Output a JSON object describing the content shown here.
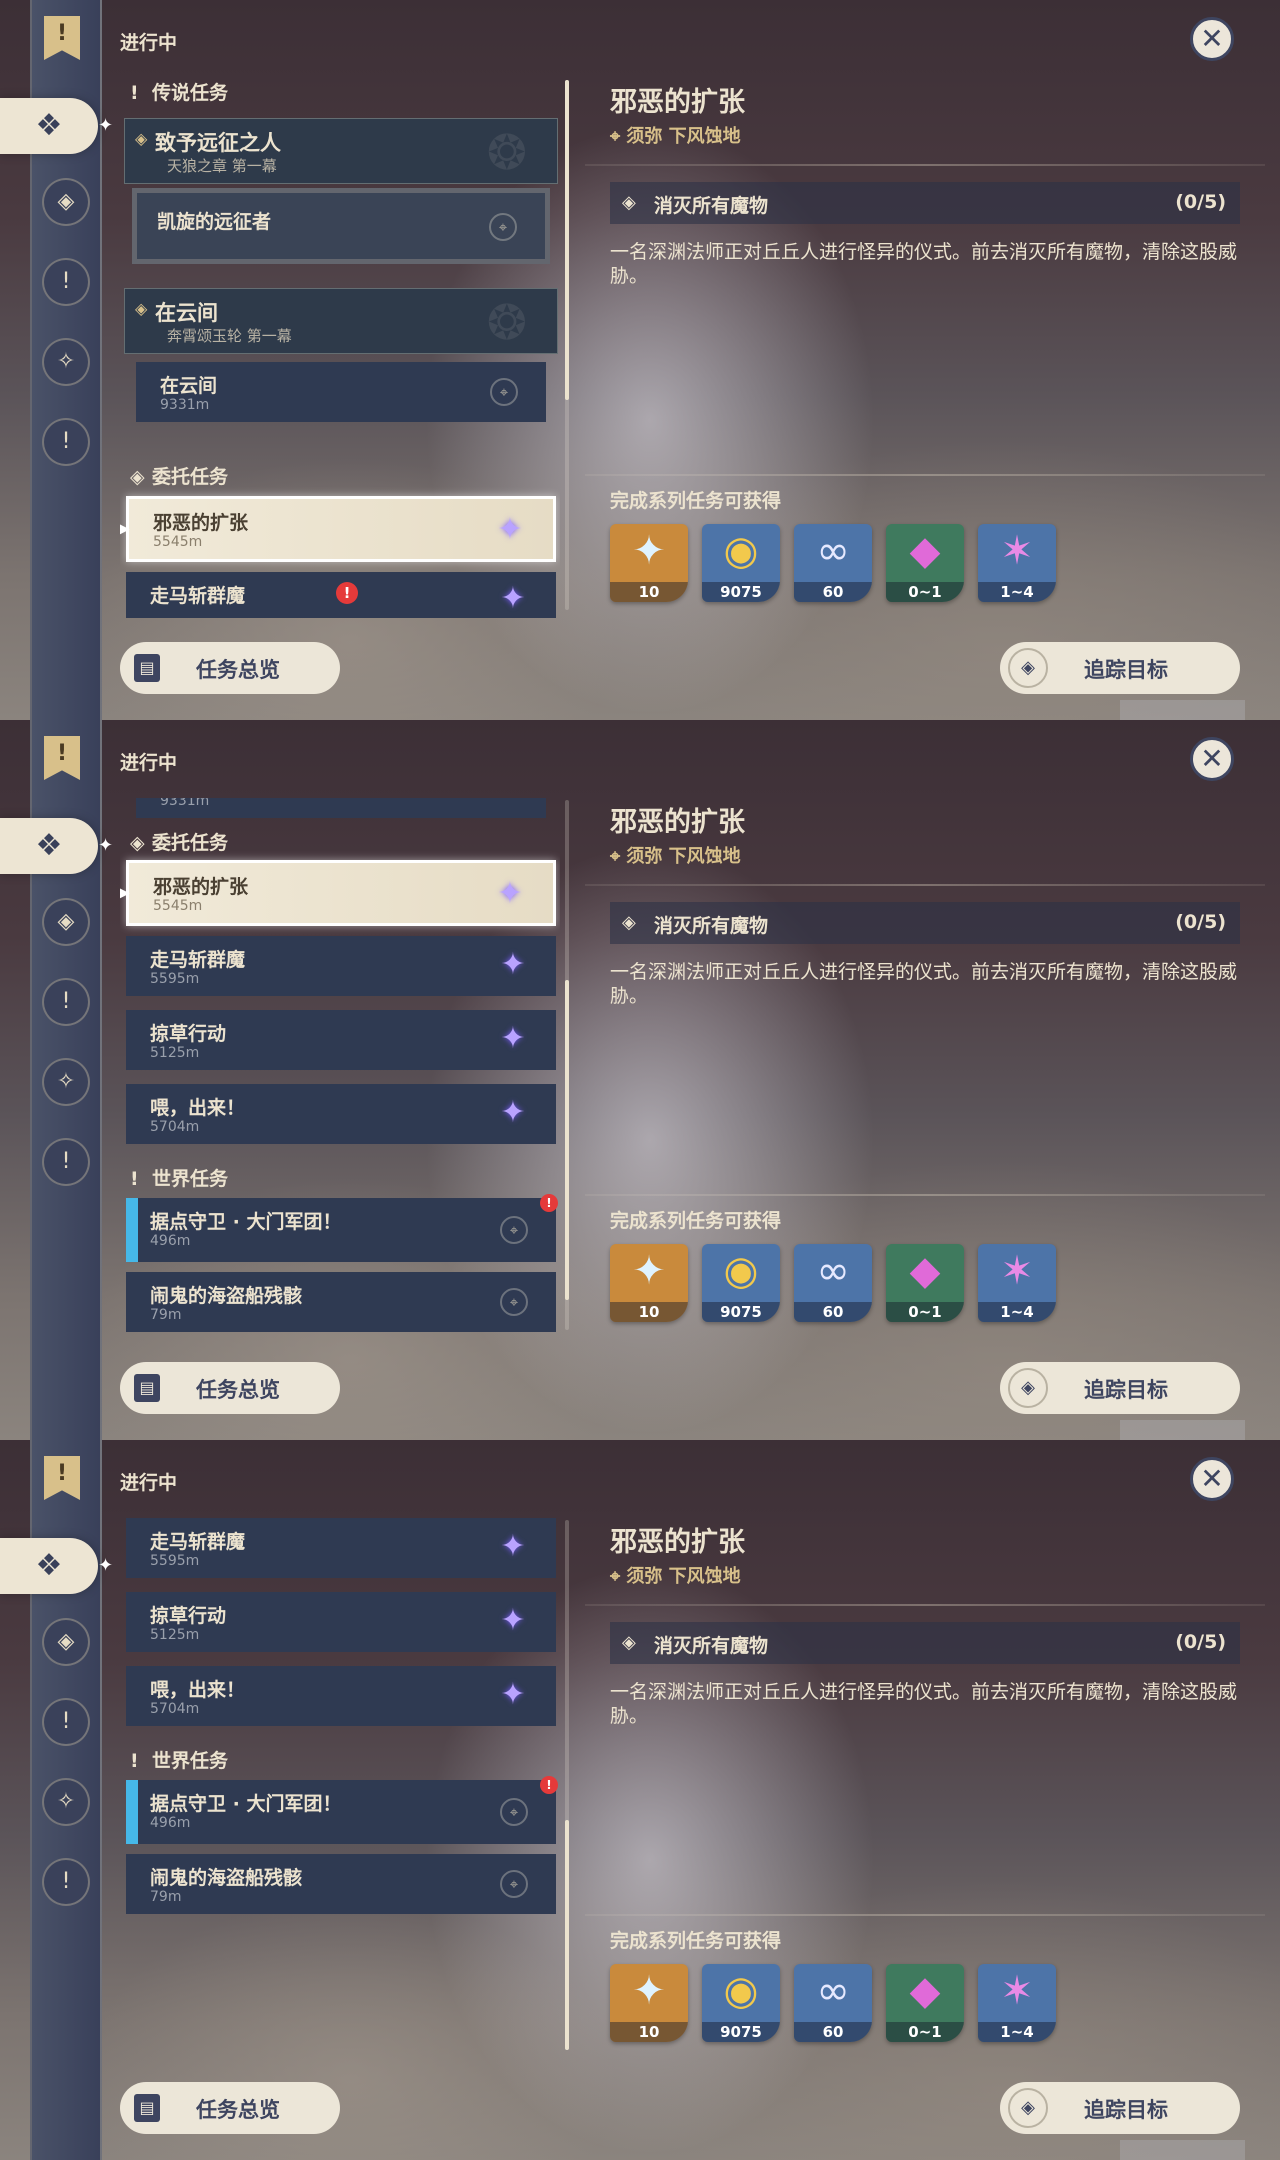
{
  "header": {
    "status_label": "进行中",
    "close_icon": "✕"
  },
  "rail": {
    "flag_glyph": "!",
    "buttons": [
      "❖",
      "◈",
      "!",
      "✧",
      "!"
    ]
  },
  "sections": {
    "legend": "传说任务",
    "commission": "委托任务",
    "world": "世界任务"
  },
  "legend_quests": [
    {
      "title": "致予远征之人",
      "subtitle": "天狼之章 第一幕",
      "step": "凯旋的远征者",
      "step_distance": ""
    },
    {
      "title": "在云间",
      "subtitle": "奔霄颂玉轮 第一幕",
      "step": "在云间",
      "step_distance": "9331m"
    }
  ],
  "commissions": [
    {
      "title": "邪恶的扩张",
      "distance": "5545m"
    },
    {
      "title": "走马斩群魔",
      "distance": "5595m"
    },
    {
      "title": "掠草行动",
      "distance": "5125m"
    },
    {
      "title": "喂，出来！",
      "distance": "5704m"
    }
  ],
  "world_quests": [
    {
      "title": "据点守卫 · 大门军团！",
      "distance": "496m"
    },
    {
      "title": "闹鬼的海盗船残骸",
      "distance": "79m"
    }
  ],
  "detail": {
    "title": "邪恶的扩张",
    "location": "须弥 下风蚀地",
    "objective": "消灭所有魔物",
    "progress": "(0/5)",
    "description": "一名深渊法师正对丘丘人进行怪异的仪式。前去消灭所有魔物，清除这股威胁。",
    "reward_header": "完成系列任务可获得",
    "rewards": [
      {
        "name": "primogem-icon",
        "glyph": "✦",
        "count": "10",
        "color": "#c98a3c"
      },
      {
        "name": "mora-icon",
        "glyph": "◉",
        "count": "9075",
        "color": "#4d74a8"
      },
      {
        "name": "companionship-icon",
        "glyph": "∞",
        "count": "60",
        "color": "#4d74a8"
      },
      {
        "name": "crystal-icon",
        "glyph": "◆",
        "count": "0~1",
        "color": "#3f7a5e"
      },
      {
        "name": "crystal-cluster-icon",
        "glyph": "✶",
        "count": "1~4",
        "color": "#4d74a8"
      }
    ]
  },
  "footer": {
    "overview_label": "任务总览",
    "track_label": "追踪目标"
  },
  "colors": {
    "accent": "#d8c08a",
    "panel": "#2f3a52",
    "alert": "#e53a3a"
  }
}
